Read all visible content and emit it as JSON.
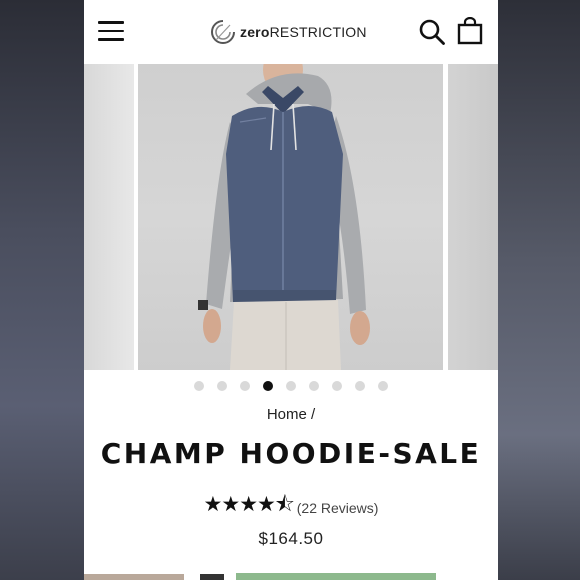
{
  "header": {
    "logo_bold": "zero",
    "logo_light": "RESTRICTION",
    "menu_icon": "hamburger-menu-icon",
    "search_icon": "search-icon",
    "cart_icon": "shopping-bag-icon"
  },
  "gallery": {
    "total_slides": 9,
    "active_index": 3,
    "zoom_icon": "magnifier-icon"
  },
  "breadcrumb": {
    "home": "Home",
    "separator": "/"
  },
  "product": {
    "title": "CHAMP HOODIE-SALE",
    "rating": 4.5,
    "stars": "★★★★⯪",
    "reviews": "(22 Reviews)",
    "price": "$164.50"
  },
  "colors": {
    "vest_navy": "#4f5e7d",
    "sleeve_gray": "#a9abae",
    "active_dot": "#111111",
    "inactive_dot": "#d9d9d9"
  }
}
